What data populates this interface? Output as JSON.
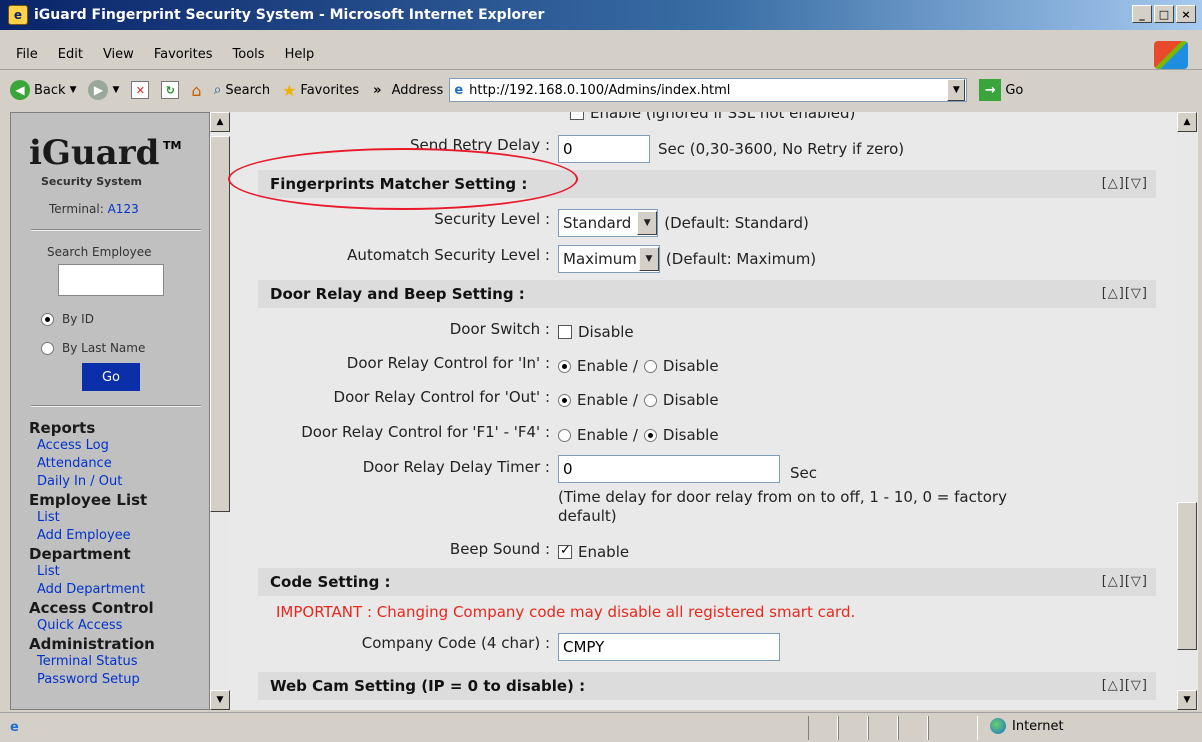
{
  "window": {
    "title": "iGuard Fingerprint Security System - Microsoft Internet Explorer",
    "controls": [
      "_",
      "□",
      "×"
    ]
  },
  "menu": [
    "File",
    "Edit",
    "View",
    "Favorites",
    "Tools",
    "Help"
  ],
  "toolbar": {
    "back_label": "Back",
    "search_label": "Search",
    "favorites_label": "Favorites",
    "more_label": "»",
    "address_label": "Address",
    "address_value": "http://192.168.0.100/Admins/index.html",
    "go_label": "Go"
  },
  "sidebar": {
    "logo": "iGuard",
    "logo_tm": "TM",
    "logo_sub": "Security System",
    "terminal_label": "Terminal:",
    "terminal_value": "A123",
    "search_label": "Search Employee",
    "radio_by_id": "By ID",
    "radio_by_last_name": "By Last Name",
    "go_label": "Go",
    "sections": [
      {
        "heading": "Reports",
        "links": [
          "Access Log",
          "Attendance",
          "Daily In / Out"
        ]
      },
      {
        "heading": "Employee List",
        "links": [
          "List",
          "Add Employee"
        ]
      },
      {
        "heading": "Department",
        "links": [
          "List",
          "Add Department"
        ]
      },
      {
        "heading": "Access Control",
        "links": [
          "Quick Access"
        ]
      },
      {
        "heading": "Administration",
        "links": [
          "Terminal Status",
          "Password Setup"
        ]
      }
    ]
  },
  "content": {
    "top_partial_text": "Enable (ignored if SSL not enabled)",
    "send_retry": {
      "label": "Send Retry Delay :",
      "value": "0",
      "hint": "Sec (0,30-3600, No Retry if zero)"
    },
    "arrows": "[△][▽]",
    "fingerprint_section": "Fingerprints Matcher Setting :",
    "security_level": {
      "label": "Security Level :",
      "value": "Standard",
      "hint": "(Default: Standard)"
    },
    "automatch_level": {
      "label": "Automatch Security Level :",
      "value": "Maximum",
      "hint": "(Default: Maximum)"
    },
    "door_section": "Door Relay and Beep Setting :",
    "door_switch": {
      "label": "Door Switch :",
      "option": "Disable"
    },
    "relay_in": {
      "label": "Door Relay Control for 'In' :",
      "enable": "Enable /",
      "disable": "Disable"
    },
    "relay_out": {
      "label": "Door Relay Control for 'Out' :",
      "enable": "Enable /",
      "disable": "Disable"
    },
    "relay_f": {
      "label": "Door Relay Control for 'F1' - 'F4' :",
      "enable": "Enable /",
      "disable": "Disable"
    },
    "relay_delay": {
      "label": "Door Relay Delay Timer :",
      "value": "0",
      "unit": "Sec",
      "hint1": "(Time delay for door relay from on to off, 1 - 10, 0 = factory",
      "hint2": "default)"
    },
    "beep": {
      "label": "Beep Sound :",
      "option": "Enable"
    },
    "code_section": "Code Setting :",
    "warning": "IMPORTANT : Changing Company code may disable all registered smart card.",
    "company_code": {
      "label": "Company Code (4 char) :",
      "value": "CMPY"
    },
    "webcam_section": "Web Cam Setting (IP = 0 to disable) :"
  },
  "status": {
    "zone": "Internet"
  },
  "colors": {
    "annotation_ellipse": "#e81a2a",
    "link": "#0033cc",
    "warning": "#e8281e",
    "go_button": "#0b2fa8"
  }
}
